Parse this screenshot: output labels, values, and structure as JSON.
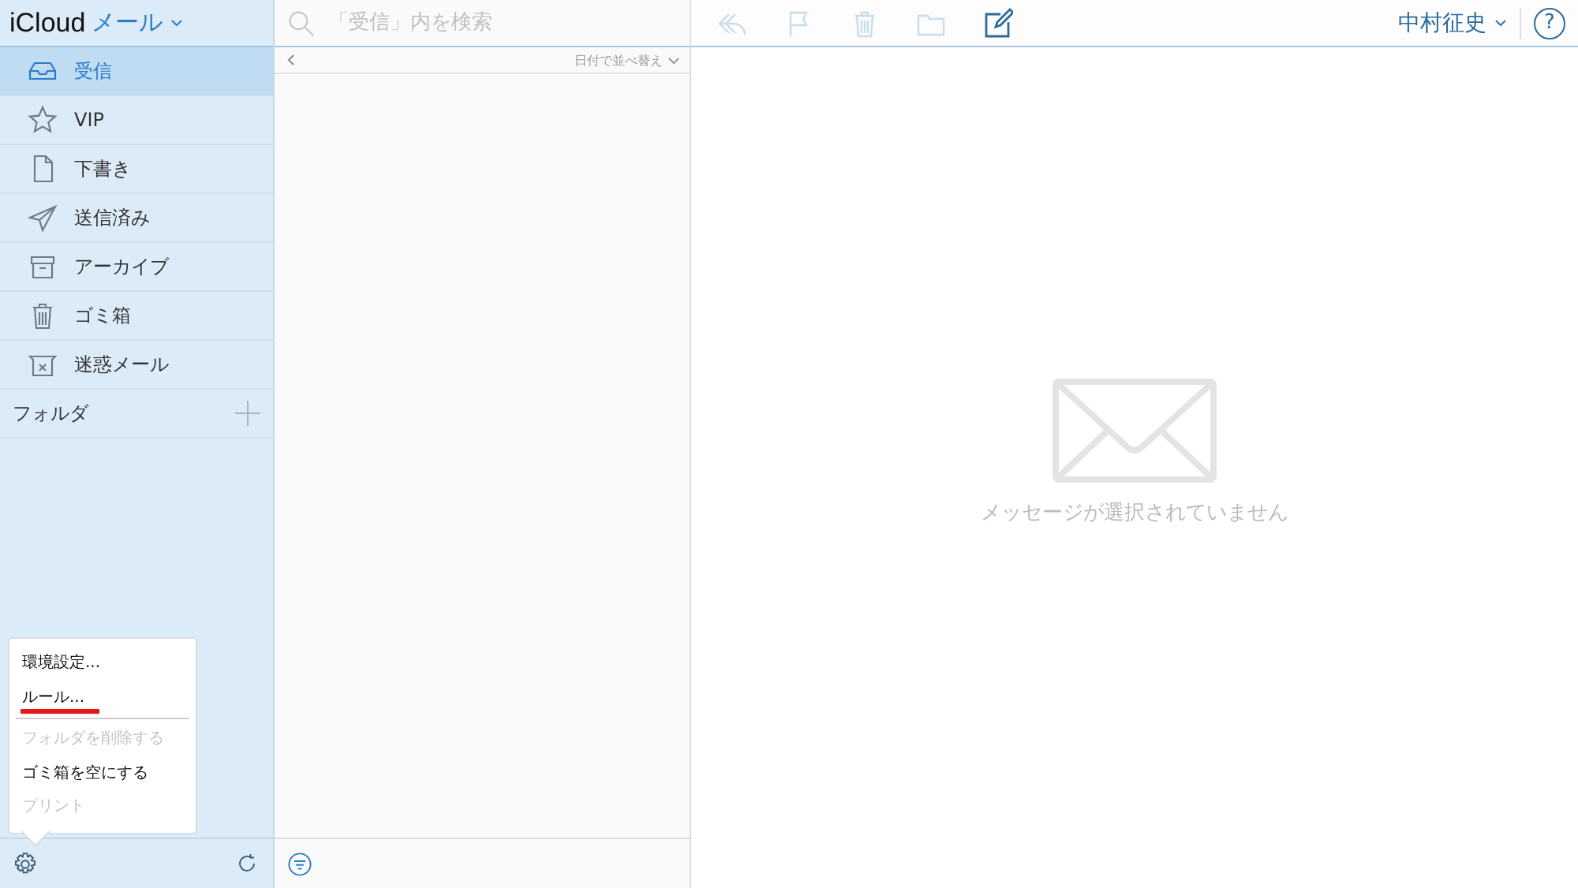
{
  "app_title": {
    "brand": "iCloud",
    "app": "メール"
  },
  "mailboxes": [
    {
      "kind": "inbox",
      "label": "受信",
      "selected": true
    },
    {
      "kind": "vip",
      "label": "VIP",
      "selected": false
    },
    {
      "kind": "drafts",
      "label": "下書き",
      "selected": false
    },
    {
      "kind": "sent",
      "label": "送信済み",
      "selected": false
    },
    {
      "kind": "archive",
      "label": "アーカイブ",
      "selected": false
    },
    {
      "kind": "trash",
      "label": "ゴミ箱",
      "selected": false
    },
    {
      "kind": "junk",
      "label": "迷惑メール",
      "selected": false
    }
  ],
  "folders_label": "フォルダ",
  "search": {
    "placeholder": "「受信」内を検索"
  },
  "sort_label": "日付で並べ替え",
  "user_name": "中村征史",
  "help": "?",
  "empty_message": "メッセージが選択されていません",
  "settings_menu": [
    {
      "label": "環境設定...",
      "disabled": false,
      "underlined": false
    },
    {
      "label": "ルール...",
      "disabled": false,
      "underlined": true
    },
    {
      "label": "フォルダを削除する",
      "disabled": true,
      "underlined": false
    },
    {
      "label": "ゴミ箱を空にする",
      "disabled": false,
      "underlined": false
    },
    {
      "label": "プリント",
      "disabled": true,
      "underlined": false
    }
  ]
}
